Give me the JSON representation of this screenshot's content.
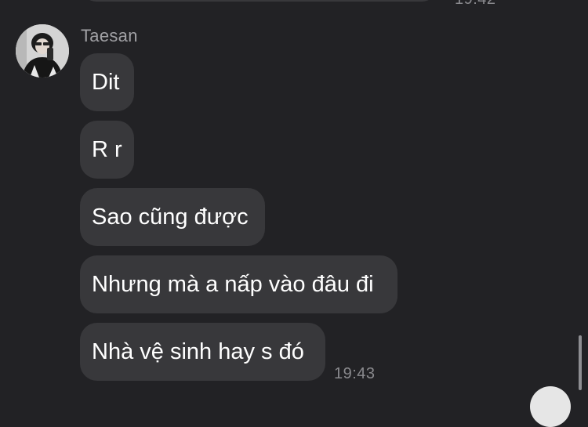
{
  "chat": {
    "sender_name": "Taesan",
    "messages": [
      {
        "text": "Dit"
      },
      {
        "text": "R r"
      },
      {
        "text": "Sao cũng được"
      },
      {
        "text": "Nhưng mà a nấp vào đâu đi"
      },
      {
        "text": "Nhà vệ sinh hay s đó"
      }
    ],
    "last_timestamp": "19:43",
    "previous_timestamp": "19:42"
  },
  "colors": {
    "background": "#222225",
    "bubble": "#38383b",
    "bubble_text": "#ffffff",
    "meta_text": "#8a8a8e"
  },
  "icons": {
    "avatar": "user-avatar-photo"
  }
}
